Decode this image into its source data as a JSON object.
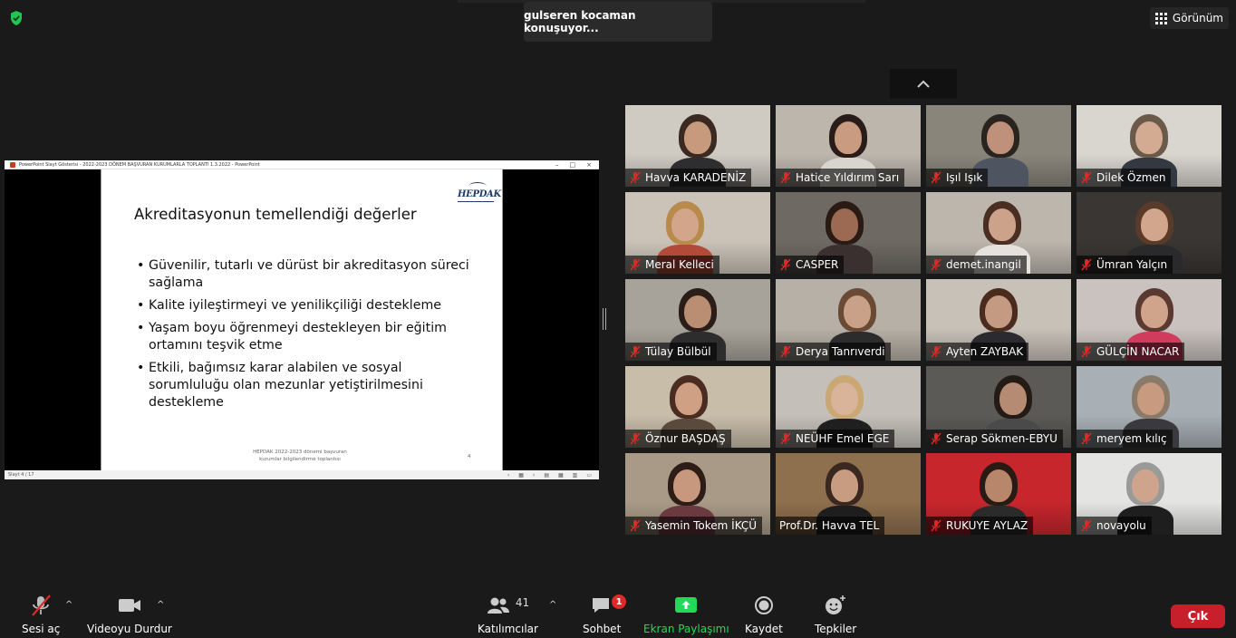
{
  "header": {
    "speaker_toast": "gulseren kocaman konuşuyor...",
    "view_label": "Görünüm",
    "security_icon": "shield-check-icon"
  },
  "share": {
    "window_title": "PowerPoint Slayt Gösterisi  -  2022-2023 DÖNEM BAŞVURAN KURUMLARLA TOPLANTI 1.3.2022 - PowerPoint",
    "status_left": "Slayt 4 / 17",
    "slide": {
      "logo": "HEPDAK",
      "title": "Akreditasyonun temellendiği değerler",
      "bullets": [
        "Güvenilir, tutarlı ve dürüst bir akreditasyon süreci sağlama",
        "Kalite iyileştirmeyi ve yenilikçiliği destekleme",
        "Yaşam boyu öğrenmeyi destekleyen bir eğitim ortamını teşvik etme",
        "Etkili, bağımsız karar alabilen  ve  sosyal sorumluluğu olan mezunlar yetiştirilmesini destekleme"
      ],
      "footer": "HEPDAK 2022-2023 dönemi başvuran kurumlar bilgilendirme toplantısı",
      "page_number": "4"
    }
  },
  "participants": [
    {
      "name": "Havva KARADENİZ",
      "muted": true,
      "bg": "#cfcac2",
      "skin": "#c79a7e",
      "hair": "#3a2a22",
      "shirt": "#2e2e30"
    },
    {
      "name": "Hatice Yıldırım Sarı",
      "muted": true,
      "bg": "#bdb6ad",
      "skin": "#c99b80",
      "hair": "#2a1d19",
      "shirt": "#d8d4ce"
    },
    {
      "name": "Işıl Işık",
      "muted": true,
      "bg": "#8a857b",
      "skin": "#c0917a",
      "hair": "#2a2420",
      "shirt": "#4f5560"
    },
    {
      "name": "Dilek Özmen",
      "muted": true,
      "bg": "#d9d5cf",
      "skin": "#d3aa92",
      "hair": "#6b5a4a",
      "shirt": "#333841"
    },
    {
      "name": "Meral Kelleci",
      "muted": true,
      "bg": "#cbc3b8",
      "skin": "#d3a58a",
      "hair": "#b88a4c",
      "shirt": "#b24a3a"
    },
    {
      "name": "CASPER",
      "muted": true,
      "bg": "#6e6a63",
      "skin": "#9c6a52",
      "hair": "#2a1a14",
      "shirt": "#3a3030"
    },
    {
      "name": "demet.inangil",
      "muted": true,
      "bg": "#bcb6ad",
      "skin": "#cda28a",
      "hair": "#4a2e22",
      "shirt": "#e5e2de"
    },
    {
      "name": "Ümran Yalçın",
      "muted": true,
      "bg": "#3a3633",
      "skin": "#d2a68c",
      "hair": "#5a3a28",
      "shirt": "#2a2a2c"
    },
    {
      "name": "Tülay Bülbül",
      "muted": true,
      "bg": "#a8a39a",
      "skin": "#b98e72",
      "hair": "#2b1e18",
      "shirt": "#2e2d2d"
    },
    {
      "name": "Derya Tanrıverdi",
      "muted": true,
      "bg": "#b7b0a6",
      "skin": "#c9a188",
      "hair": "#6a4a34",
      "shirt": "#2c2c2c"
    },
    {
      "name": "Ayten ZAYBAK",
      "muted": true,
      "bg": "#c7c1b8",
      "skin": "#c59a82",
      "hair": "#4a2c1e",
      "shirt": "#2b2b2f"
    },
    {
      "name": "GÜLÇİN NACAR",
      "muted": true,
      "bg": "#c9c2be",
      "skin": "#d0a38b",
      "hair": "#5a3a30",
      "shirt": "#cf3c5e"
    },
    {
      "name": "Öznur BAŞDAŞ",
      "muted": true,
      "bg": "#c8bda9",
      "skin": "#d0a084",
      "hair": "#4a2c20",
      "shirt": "#5a4a3e"
    },
    {
      "name": "NEÜHF Emel EGE",
      "muted": true,
      "bg": "#c4c0b9",
      "skin": "#d9b39a",
      "hair": "#c9a873",
      "shirt": "#1f1f20"
    },
    {
      "name": "Serap Sökmen-EBYU",
      "muted": true,
      "bg": "#5c5a56",
      "skin": "#b58c73",
      "hair": "#241a16",
      "shirt": "#4a4a4a"
    },
    {
      "name": "meryem kılıç",
      "muted": true,
      "bg": "#a8b0b5",
      "skin": "#c89a80",
      "hair": "#8a7a6a",
      "shirt": "#3a3a3e"
    },
    {
      "name": "Yasemin Tokem İKÇÜ",
      "muted": true,
      "bg": "#a89a86",
      "skin": "#c7987e",
      "hair": "#2d1d16",
      "shirt": "#6b3a40"
    },
    {
      "name": "Prof.Dr. Havva TEL",
      "muted": false,
      "bg": "#8e6f4e",
      "skin": "#c89c80",
      "hair": "#3a2820",
      "shirt": "#1e1e1e"
    },
    {
      "name": "RUKUYE AYLAZ",
      "muted": true,
      "bg": "#c7262d",
      "skin": "#b8866a",
      "hair": "#2a1a14",
      "shirt": "#2b2b2b"
    },
    {
      "name": "novayolu",
      "muted": true,
      "bg": "#e4e4e2",
      "skin": "#cfa48c",
      "hair": "#9a9a98",
      "shirt": "#1e1e1e"
    }
  ],
  "toolbar": {
    "audio_label": "Sesi aç",
    "video_label": "Videoyu Durdur",
    "participants_label": "Katılımcılar",
    "participants_count": "41",
    "chat_label": "Sohbet",
    "chat_badge": "1",
    "share_label": "Ekran Paylaşımı",
    "record_label": "Kaydet",
    "reactions_label": "Tepkiler",
    "leave_label": "Çık",
    "share_color": "#23d959",
    "leave_color": "#c8202a"
  }
}
